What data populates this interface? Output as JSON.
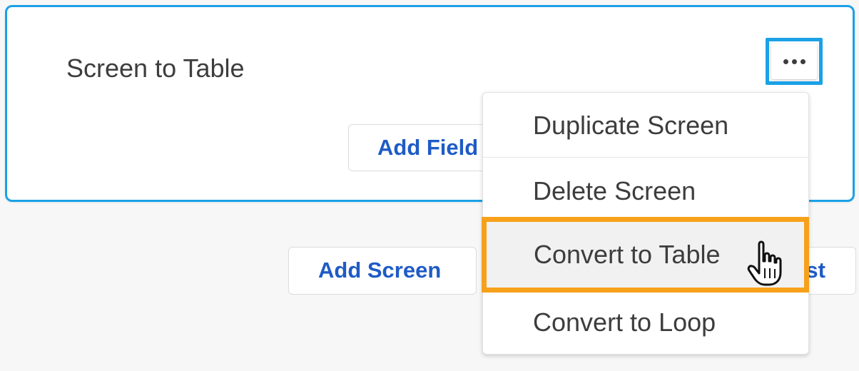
{
  "card": {
    "title": "Screen to Table"
  },
  "buttons": {
    "add_field": "Add Field",
    "add_screen": "Add Screen",
    "add_list_partial": "st"
  },
  "menu": {
    "items": [
      {
        "label": "Duplicate Screen"
      },
      {
        "label": "Delete Screen"
      },
      {
        "label": "Convert to Table"
      },
      {
        "label": "Convert to Loop"
      }
    ],
    "highlighted_index": 2
  },
  "colors": {
    "accent_blue": "#1aa1e6",
    "link_blue": "#1f5bc6",
    "highlight_orange": "#f7a11a",
    "text_dark": "#3d3d3d",
    "page_background": "#f7f7f7"
  },
  "icons": {
    "more_button": "more-horizontal-icon",
    "cursor": "hand-pointer-icon"
  }
}
